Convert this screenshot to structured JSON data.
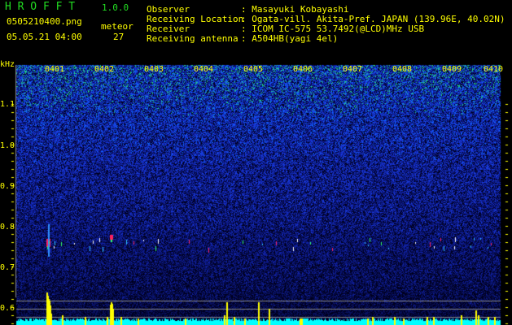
{
  "app": {
    "name": "H R O F F T",
    "version": "1.0.0"
  },
  "file_name": "0505210400.png",
  "datetime": "05.05.21 04:00",
  "meteor": {
    "label": "meteor",
    "count": "27"
  },
  "info": [
    {
      "label": "Observer",
      "value": ": Masayuki Kobayashi"
    },
    {
      "label": "Receiving Location",
      "value": ": Ogata-vill. Akita-Pref. JAPAN (139.96E, 40.02N)"
    },
    {
      "label": "Receiver",
      "value": ": ICOM IC-575 53.7492(@LCD)MHz USB"
    },
    {
      "label": "Receiving antenna",
      "value": ": A504HB(yagi 4el)"
    }
  ],
  "y_axis": {
    "unit": "kHz",
    "ticks": [
      "1.1",
      "1.0",
      "0.9",
      "0.8",
      "0.7",
      "0.6"
    ]
  },
  "x_axis": {
    "ticks": [
      "0401",
      "0402",
      "0403",
      "0404",
      "0405",
      "0406",
      "0407",
      "0408",
      "0409",
      "0410"
    ]
  },
  "colors": {
    "text": "#ffff00",
    "title": "#22dd22",
    "histogram": "#00ffff",
    "spikes": "#ffff00",
    "echo": "#ff2060"
  }
}
